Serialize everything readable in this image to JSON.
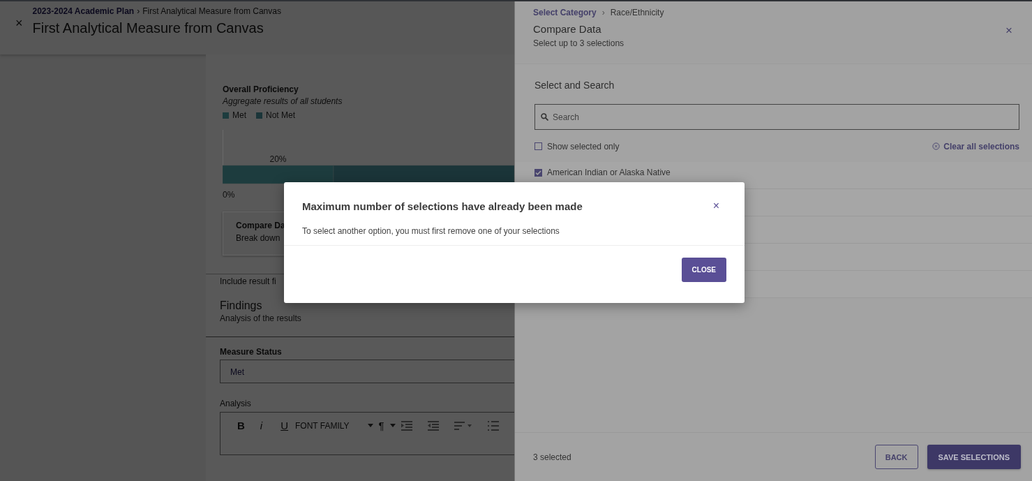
{
  "page": {
    "close_icon": "×",
    "breadcrumb": {
      "parent": "2023-2024 Academic Plan",
      "separator": "›",
      "current": "First Analytical Measure from Canvas"
    },
    "title": "First Analytical Measure from Canvas"
  },
  "proficiency": {
    "title": "Overall Proficiency",
    "subtitle": "Aggregate results of all students",
    "legend": [
      {
        "label": "Met",
        "color": "#1d3c3e"
      },
      {
        "label": "Not Met",
        "color": "#1b3539"
      }
    ],
    "bar_label": "20%",
    "axis_label": "0%"
  },
  "compare_card": {
    "title": "Compare Da",
    "text": "Break down"
  },
  "include_text": "Include result fi",
  "findings": {
    "title": "Findings",
    "subtitle": "Analysis of the results"
  },
  "measure_status": {
    "label": "Measure Status",
    "value": "Met"
  },
  "analysis": {
    "label": "Analysis",
    "toolbar": [
      {
        "kind": "bold",
        "label": "B"
      },
      {
        "kind": "italic",
        "label": "i"
      },
      {
        "kind": "underline",
        "label": "U"
      },
      {
        "kind": "dropdown",
        "label": "FONT FAMILY"
      },
      {
        "kind": "dropdown",
        "label": "¶"
      },
      {
        "kind": "indent"
      },
      {
        "kind": "outdent"
      },
      {
        "kind": "align"
      },
      {
        "kind": "list"
      }
    ]
  },
  "drawer": {
    "breadcrumb": {
      "link": "Select Category",
      "separator": "›",
      "current": "Race/Ethnicity"
    },
    "title": "Compare Data",
    "subtitle": "Select up to 3 selections",
    "close_icon": "×",
    "section_title": "Select and Search",
    "search": {
      "placeholder": "Search"
    },
    "show_selected": {
      "label": "Show selected only",
      "checked": false
    },
    "clear_all": "Clear all selections",
    "options": [
      {
        "label": "American Indian or Alaska Native",
        "checked": true
      }
    ],
    "footer": {
      "count": "3 selected",
      "buttons": [
        {
          "kind": "outline",
          "label": "BACK"
        },
        {
          "kind": "primary",
          "label": "SAVE SELECTIONS"
        }
      ]
    }
  },
  "modal": {
    "title": "Maximum number of selections have already been made",
    "close_icon": "×",
    "message": "To select another option, you must first remove one of your selections",
    "button": "CLOSE"
  }
}
